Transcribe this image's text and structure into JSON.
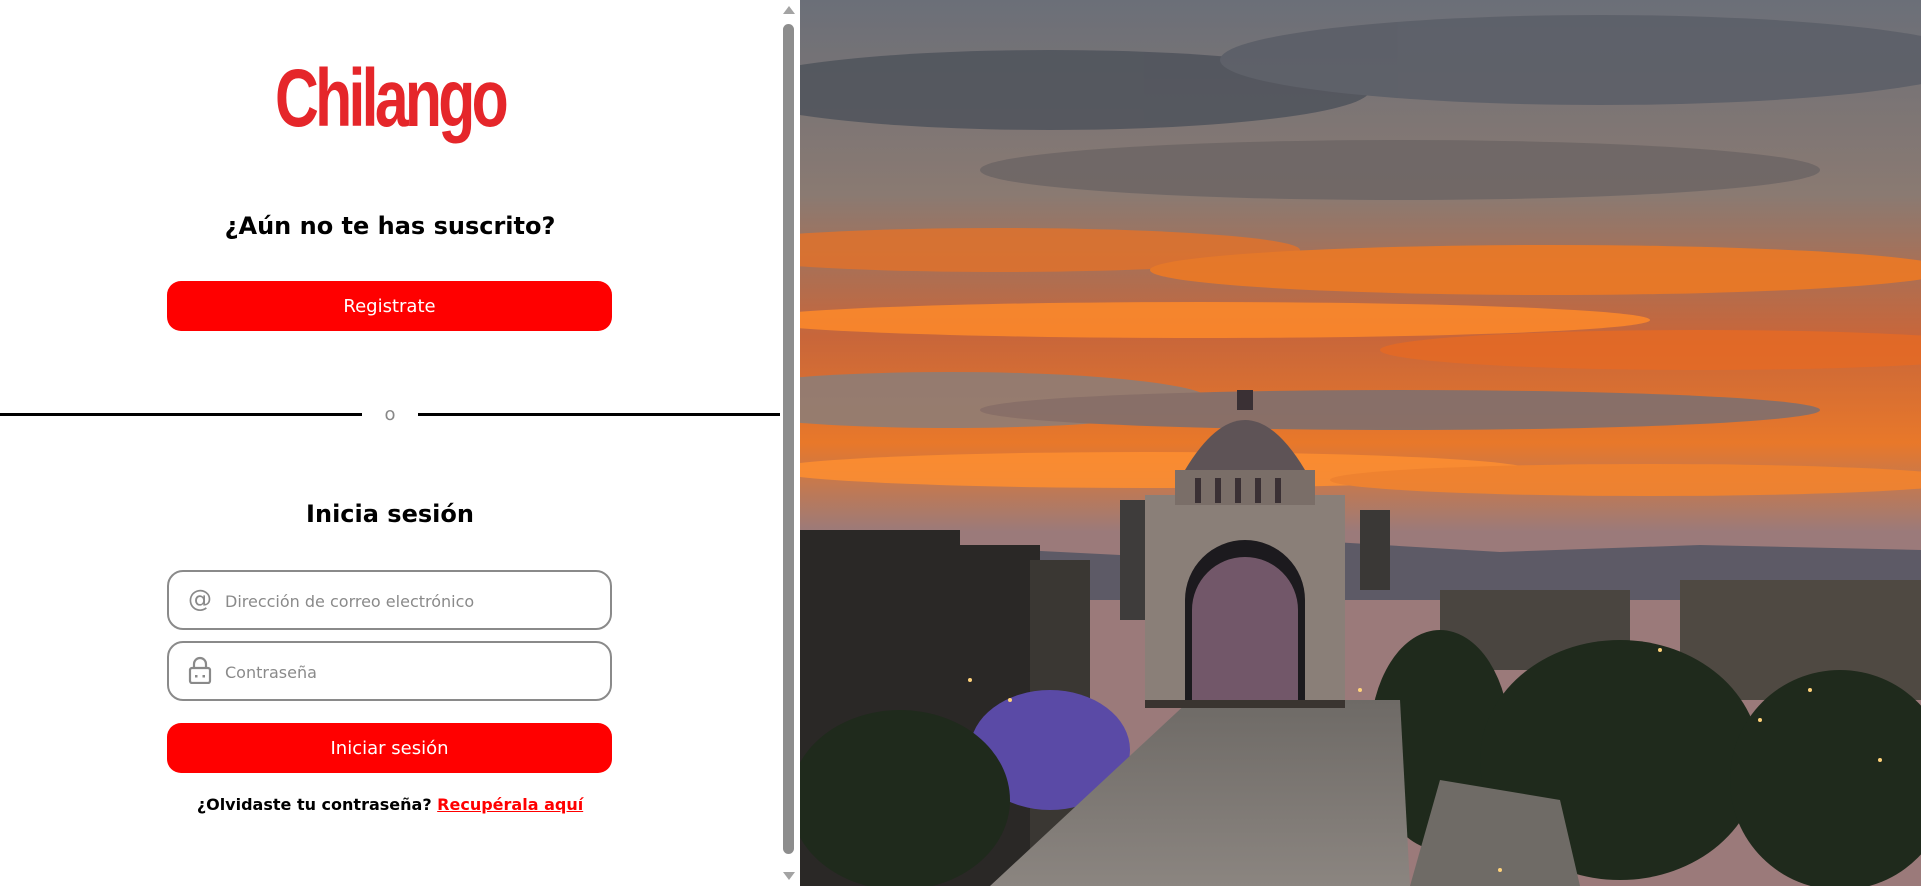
{
  "brand": {
    "logo_text": "Chilango",
    "color": "#e5262a"
  },
  "signup": {
    "heading": "¿Aún no te has suscrito?",
    "button_label": "Registrate"
  },
  "divider": {
    "text": "o"
  },
  "login": {
    "heading": "Inicia sesión",
    "email_placeholder": "Dirección de correo electrónico",
    "password_placeholder": "Contraseña",
    "button_label": "Iniciar sesión",
    "forgot_text": "¿Olvidaste tu contraseña?",
    "recover_link": "Recupérala aquí"
  },
  "icons": {
    "email": "at-icon",
    "password": "lock-icon"
  },
  "colors": {
    "primary_red": "#ff0000",
    "field_border": "#8a8a8a"
  }
}
